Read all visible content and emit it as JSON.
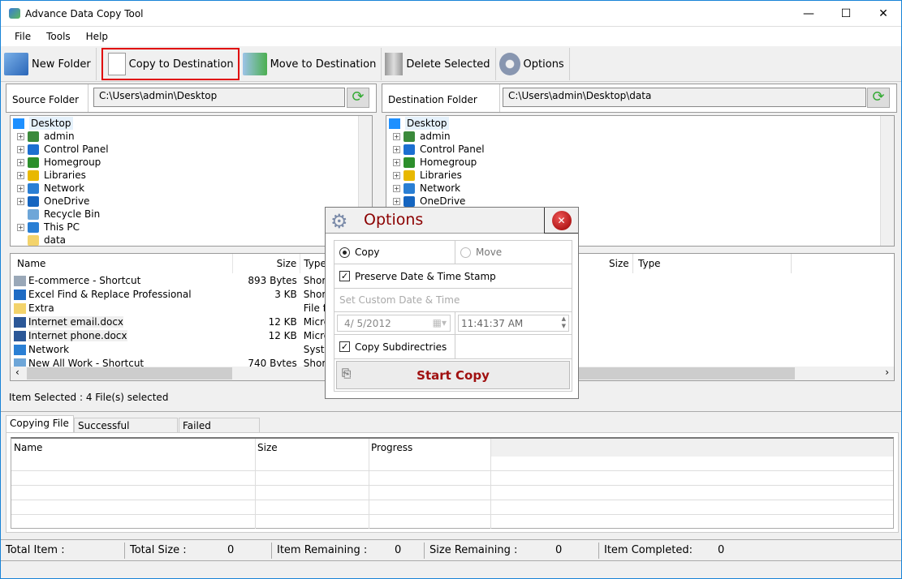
{
  "window": {
    "title": "Advance Data Copy Tool",
    "controls": [
      "—",
      "☐",
      "✕"
    ]
  },
  "menu": [
    "File",
    "Tools",
    "Help"
  ],
  "toolbar": [
    {
      "label": "New Folder",
      "icon": "new-folder-icon"
    },
    {
      "label": "Copy to Destination",
      "icon": "copy-icon",
      "selected": true
    },
    {
      "label": "Move to Destination",
      "icon": "move-icon"
    },
    {
      "label": "Delete Selected",
      "icon": "trash-icon"
    },
    {
      "label": "Options",
      "icon": "gear-icon"
    }
  ],
  "source": {
    "label": "Source Folder",
    "path": "C:\\Users\\admin\\Desktop",
    "tree": [
      {
        "label": "Desktop",
        "root": true
      },
      {
        "label": "admin",
        "exp": true
      },
      {
        "label": "Control Panel",
        "exp": true
      },
      {
        "label": "Homegroup",
        "exp": true
      },
      {
        "label": "Libraries",
        "exp": true
      },
      {
        "label": "Network",
        "exp": true
      },
      {
        "label": "OneDrive",
        "exp": true
      },
      {
        "label": "Recycle Bin",
        "exp": false
      },
      {
        "label": "This PC",
        "exp": true
      },
      {
        "label": "data",
        "exp": false
      }
    ],
    "columns": [
      "Name",
      "Size",
      "Type"
    ],
    "files": [
      {
        "name": "E-commerce - Shortcut",
        "size": "893 Bytes",
        "type": "Shortcut"
      },
      {
        "name": "Excel Find & Replace Professional",
        "size": "3 KB",
        "type": "Shortcut"
      },
      {
        "name": "Extra",
        "size": "",
        "type": "File folder"
      },
      {
        "name": "Internet email.docx",
        "size": "12 KB",
        "type": "Microsoft Offi"
      },
      {
        "name": "Internet phone.docx",
        "size": "12 KB",
        "type": "Microsoft Offi"
      },
      {
        "name": "Network",
        "size": "",
        "type": "System Folde"
      },
      {
        "name": "New All Work - Shortcut",
        "size": "740 Bytes",
        "type": "Shortcut"
      }
    ],
    "selection": "Item Selected :  4 File(s) selected"
  },
  "destination": {
    "label": "Destination Folder",
    "path": "C:\\Users\\admin\\Desktop\\data",
    "tree": [
      {
        "label": "Desktop",
        "root": true
      },
      {
        "label": "admin",
        "exp": true
      },
      {
        "label": "Control Panel",
        "exp": true
      },
      {
        "label": "Homegroup",
        "exp": true
      },
      {
        "label": "Libraries",
        "exp": true
      },
      {
        "label": "Network",
        "exp": true
      },
      {
        "label": "OneDrive",
        "exp": true
      }
    ],
    "columns": [
      "Size",
      "Type"
    ]
  },
  "tabs": [
    "Copying File",
    "Successful Transfers",
    "Failed Transfers"
  ],
  "grid": {
    "columns": [
      "Name",
      "Size",
      "Progress"
    ]
  },
  "status": [
    {
      "label": "Total Item :",
      "value": ""
    },
    {
      "label": "Total Size :",
      "value": "0"
    },
    {
      "label": "Item Remaining :",
      "value": "0"
    },
    {
      "label": "Size Remaining :",
      "value": "0"
    },
    {
      "label": "Item Completed:",
      "value": "0"
    }
  ],
  "options": {
    "title": "Options",
    "copy": "Copy",
    "move": "Move",
    "mode": "copy",
    "preserve": "Preserve Date & Time Stamp",
    "preserve_checked": true,
    "custom": "Set Custom Date & Time",
    "date": "4/  5/2012",
    "time": "11:41:37 AM",
    "subdirs": "Copy Subdirectries",
    "subdirs_checked": true,
    "start": "Start Copy"
  },
  "colors": {
    "accent": "#1883d7",
    "dialog_title": "#8b0000",
    "highlight": "#e00000"
  }
}
